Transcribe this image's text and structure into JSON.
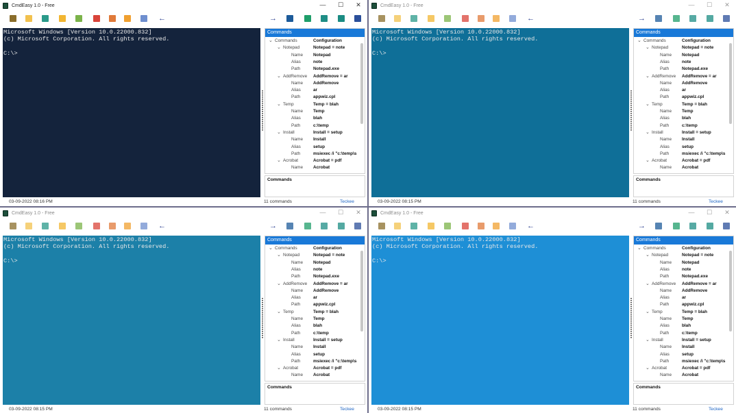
{
  "windows": [
    {
      "title": "CmdEasy 1.0 - Free",
      "active": true,
      "console_bg": "#14233c",
      "console_lines": [
        "Microsoft Windows [Version 10.0.22000.832]",
        "(c) Microsoft Corporation. All rights reserved.",
        "",
        "C:\\>"
      ],
      "status_time": "03-09-2022  08:16 PM"
    },
    {
      "title": "CmdEasy 1.0 - Free",
      "active": false,
      "console_bg": "#0f6f98",
      "console_lines": [
        "Microsoft Windows [Version 10.0.22000.832]",
        "(c) Microsoft Corporation. All rights reserved.",
        "",
        "C:\\>"
      ],
      "status_time": "03-09-2022  08:15 PM"
    },
    {
      "title": "CmdEasy 1.0 - Free",
      "active": false,
      "console_bg": "#1c80a8",
      "console_lines": [
        "Microsoft Windows [Version 10.0.22000.832]",
        "(c) Microsoft Corporation. All rights reserved.",
        "",
        "C:\\>"
      ],
      "status_time": "03-09-2022  08:15 PM"
    },
    {
      "title": "CmdEasy 1.0 - Free",
      "active": false,
      "console_bg": "#1e8fd6",
      "console_lines": [
        "Microsoft Windows [Version 10.0.22000.832]",
        "(c) Microsoft Corporation. All rights reserved.",
        "",
        "C:\\>"
      ],
      "status_time": "03-09-2022  08:15 PM"
    }
  ],
  "caption_buttons": {
    "minimize": "—",
    "maximize": "☐",
    "close": "✕"
  },
  "toolbar_icons": [
    {
      "name": "run-icon",
      "color": "#8a6d2b"
    },
    {
      "name": "open-folder-icon",
      "color": "#f2c14e"
    },
    {
      "name": "bookmark-icon",
      "color": "#2a9a8a"
    },
    {
      "name": "note-icon",
      "color": "#f2b632"
    },
    {
      "name": "screen-icon",
      "color": "#7bb34a"
    },
    {
      "name": "pin-icon",
      "color": "#d9443a"
    },
    {
      "name": "settings-icon",
      "color": "#e07a3a"
    },
    {
      "name": "move-icon",
      "color": "#f0a030"
    },
    {
      "name": "info-icon",
      "color": "#6f8fcf"
    },
    {
      "name": "back-arrow-icon",
      "color": "#2a3e8f"
    },
    {
      "name": "forward-arrow-icon",
      "color": "#2a3e8f"
    },
    {
      "name": "shell-icon",
      "color": "#1d5b9a"
    },
    {
      "name": "edit-icon",
      "color": "#1f9e6a"
    },
    {
      "name": "add-icon",
      "color": "#1f8e86"
    },
    {
      "name": "delete-icon",
      "color": "#1b8c83"
    },
    {
      "name": "console-icon",
      "color": "#2b4f9a"
    }
  ],
  "panel": {
    "header": "Commands",
    "tree_header": {
      "left": "Commands",
      "right": "Configuration"
    },
    "rows": [
      {
        "kind": "group",
        "left": "Notepad",
        "right": "Notepad = note"
      },
      {
        "kind": "prop",
        "left": "Name",
        "right": "Notepad"
      },
      {
        "kind": "prop",
        "left": "Alias",
        "right": "note"
      },
      {
        "kind": "prop",
        "left": "Path",
        "right": "Notepad.exe"
      },
      {
        "kind": "group",
        "left": "AddRemove",
        "right": "AddRemove = ar"
      },
      {
        "kind": "prop",
        "left": "Name",
        "right": "AddRemove"
      },
      {
        "kind": "prop",
        "left": "Alias",
        "right": "ar"
      },
      {
        "kind": "prop",
        "left": "Path",
        "right": "appwiz.cpl"
      },
      {
        "kind": "group",
        "left": "Temp",
        "right": "Temp = blah"
      },
      {
        "kind": "prop",
        "left": "Name",
        "right": "Temp"
      },
      {
        "kind": "prop",
        "left": "Alias",
        "right": "blah"
      },
      {
        "kind": "prop",
        "left": "Path",
        "right": "c:\\temp"
      },
      {
        "kind": "group",
        "left": "Install",
        "right": "Install = setup"
      },
      {
        "kind": "prop",
        "left": "Name",
        "right": "Install"
      },
      {
        "kind": "prop",
        "left": "Alias",
        "right": "setup"
      },
      {
        "kind": "prop",
        "left": "Path",
        "right": "msiexec /i \"c:\\temp\\s"
      },
      {
        "kind": "group",
        "left": "Acrobat",
        "right": "Acrobat = pdf"
      },
      {
        "kind": "prop",
        "left": "Name",
        "right": "Acrobat"
      }
    ],
    "description_title": "Commands"
  },
  "status": {
    "count": "11 commands",
    "link": "Teckee"
  }
}
